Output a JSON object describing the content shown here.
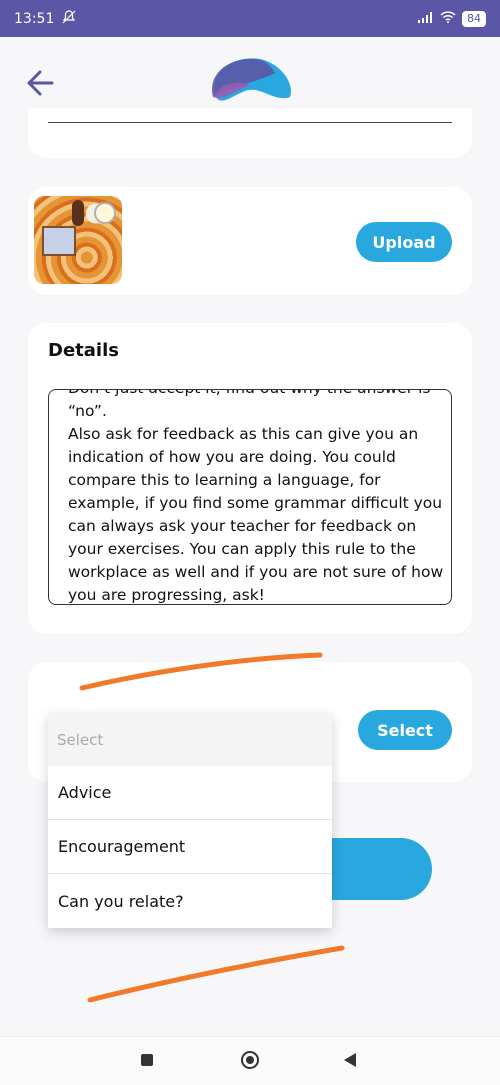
{
  "status_bar": {
    "time": "13:51",
    "battery": "84"
  },
  "upload": {
    "button_label": "Upload"
  },
  "details": {
    "title": "Details",
    "text": "Don’t just accept it, find out why the answer is\n“no”.\nAlso ask for feedback as this can give you an indication of how you are doing. You could compare this to learning a language, for example, if you find some grammar difficult you can always ask your teacher for feedback on your exercises. You can apply this rule to the workplace as well and if you are not sure of how you are progressing, ask!"
  },
  "select": {
    "button_label": "Select"
  },
  "dropdown": {
    "placeholder": "Select",
    "options": [
      "Advice",
      "Encouragement",
      "Can you relate?"
    ]
  },
  "colors": {
    "accent": "#29a8e0",
    "status_bar": "#5b56a6",
    "annotation": "#f07a2a"
  },
  "icons": {
    "back": "back-arrow-icon",
    "logo": "app-logo-icon",
    "mute": "bell-off-icon",
    "signal": "signal-icon",
    "wifi": "wifi-icon"
  }
}
